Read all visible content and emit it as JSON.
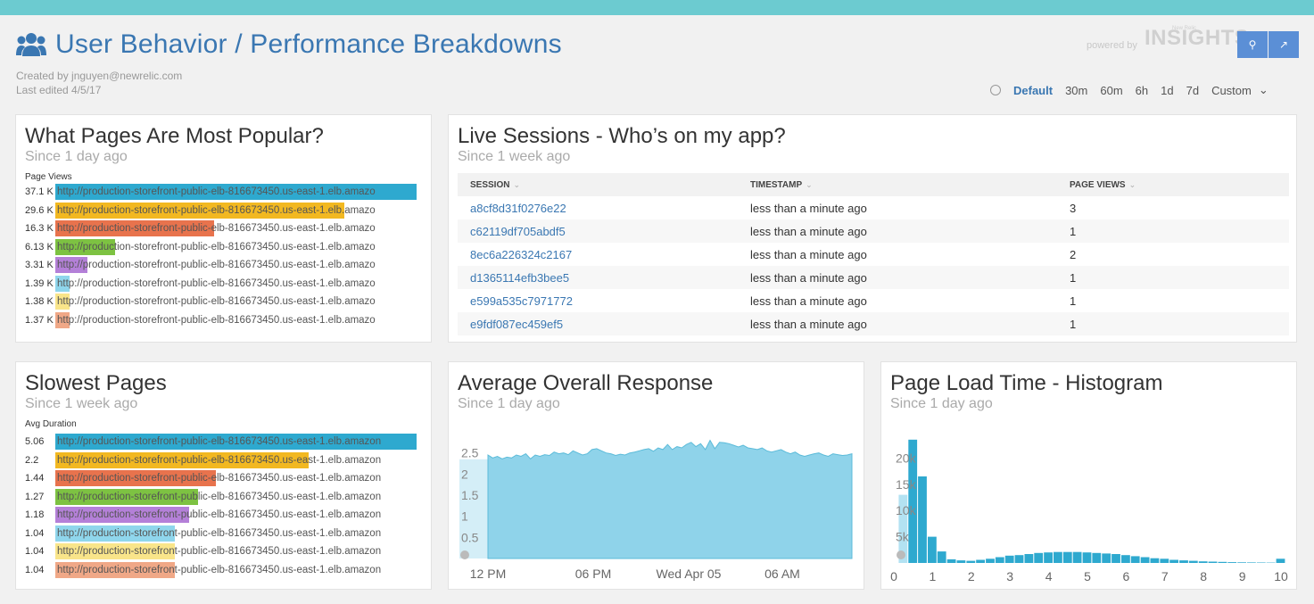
{
  "header": {
    "title": "User Behavior / Performance Breakdowns",
    "created_by": "Created by jnguyen@newrelic.com",
    "last_edited": "Last edited 4/5/17",
    "powered_by": "powered by",
    "insights_brand": "INSIGHTS",
    "insights_small": "New Relic",
    "time_options": [
      "Default",
      "30m",
      "60m",
      "6h",
      "1d",
      "7d",
      "Custom"
    ],
    "selected_time": "Default"
  },
  "popular_pages": {
    "title": "What Pages Are Most Popular?",
    "subtitle": "Since 1 day ago",
    "label": "Page Views",
    "rows": [
      {
        "value": "37.1 K",
        "fraction": 1.0,
        "color": "#2ea9cf",
        "url": "http://production-storefront-public-elb-816673450.us-east-1.elb.amazo"
      },
      {
        "value": "29.6 K",
        "fraction": 0.8,
        "color": "#f2b821",
        "url": "http://production-storefront-public-elb-816673450.us-east-1.elb.amazo"
      },
      {
        "value": "16.3 K",
        "fraction": 0.44,
        "color": "#e8734d",
        "url": "http://production-storefront-public-elb-816673450.us-east-1.elb.amazo"
      },
      {
        "value": "6.13 K",
        "fraction": 0.165,
        "color": "#7dc242",
        "url": "http://production-storefront-public-elb-816673450.us-east-1.elb.amazo"
      },
      {
        "value": "3.31 K",
        "fraction": 0.09,
        "color": "#b480d8",
        "url": "http://production-storefront-public-elb-816673450.us-east-1.elb.amazo"
      },
      {
        "value": "1.39 K",
        "fraction": 0.04,
        "color": "#8fd6ec",
        "url": "http://production-storefront-public-elb-816673450.us-east-1.elb.amazo"
      },
      {
        "value": "1.38 K",
        "fraction": 0.04,
        "color": "#f9e58a",
        "url": "http://production-storefront-public-elb-816673450.us-east-1.elb.amazo"
      },
      {
        "value": "1.37 K",
        "fraction": 0.04,
        "color": "#f0a887",
        "url": "http://production-storefront-public-elb-816673450.us-east-1.elb.amazo"
      }
    ]
  },
  "live_sessions": {
    "title": "Live Sessions - Who’s on my app?",
    "subtitle": "Since 1 week ago",
    "columns": [
      "SESSION",
      "TIMESTAMP",
      "PAGE VIEWS"
    ],
    "rows": [
      [
        "a8cf8d31f0276e22",
        "less than a minute ago",
        "3"
      ],
      [
        "c62119df705abdf5",
        "less than a minute ago",
        "1"
      ],
      [
        "8ec6a226324c2167",
        "less than a minute ago",
        "2"
      ],
      [
        "d1365114efb3bee5",
        "less than a minute ago",
        "1"
      ],
      [
        "e599a535c7971772",
        "less than a minute ago",
        "1"
      ],
      [
        "e9fdf087ec459ef5",
        "less than a minute ago",
        "1"
      ]
    ]
  },
  "slowest_pages": {
    "title": "Slowest Pages",
    "subtitle": "Since 1 week ago",
    "label": "Avg Duration",
    "rows": [
      {
        "value": "5.06",
        "fraction": 1.0,
        "color": "#2ea9cf",
        "url": "http://production-storefront-public-elb-816673450.us-east-1.elb.amazon"
      },
      {
        "value": "2.2",
        "fraction": 0.7,
        "color": "#f2b821",
        "url": "http://production-storefront-public-elb-816673450.us-east-1.elb.amazon"
      },
      {
        "value": "1.44",
        "fraction": 0.445,
        "color": "#e8734d",
        "url": "http://production-storefront-public-elb-816673450.us-east-1.elb.amazon"
      },
      {
        "value": "1.27",
        "fraction": 0.395,
        "color": "#7dc242",
        "url": "http://production-storefront-public-elb-816673450.us-east-1.elb.amazon"
      },
      {
        "value": "1.18",
        "fraction": 0.37,
        "color": "#b480d8",
        "url": "http://production-storefront-public-elb-816673450.us-east-1.elb.amazon"
      },
      {
        "value": "1.04",
        "fraction": 0.33,
        "color": "#8fd6ec",
        "url": "http://production-storefront-public-elb-816673450.us-east-1.elb.amazon"
      },
      {
        "value": "1.04",
        "fraction": 0.33,
        "color": "#f9e58a",
        "url": "http://production-storefront-public-elb-816673450.us-east-1.elb.amazon"
      },
      {
        "value": "1.04",
        "fraction": 0.33,
        "color": "#f0a887",
        "url": "http://production-storefront-public-elb-816673450.us-east-1.elb.amazon"
      }
    ]
  },
  "avg_response": {
    "title": "Average Overall Response",
    "subtitle": "Since 1 day ago"
  },
  "histogram": {
    "title": "Page Load Time - Histogram",
    "subtitle": "Since 1 day ago"
  },
  "chart_data": [
    {
      "type": "area",
      "title": "Average Overall Response",
      "x_ticks": [
        "12 PM",
        "06 PM",
        "Wed Apr 05",
        "06 AM"
      ],
      "y_ticks": [
        0.5,
        1,
        1.5,
        2,
        2.5
      ],
      "ylim": [
        0,
        3
      ],
      "color": "#8fd3ea",
      "values": [
        2.45,
        2.38,
        2.42,
        2.36,
        2.4,
        2.38,
        2.45,
        2.42,
        2.48,
        2.36,
        2.45,
        2.42,
        2.46,
        2.44,
        2.52,
        2.48,
        2.5,
        2.46,
        2.55,
        2.5,
        2.45,
        2.48,
        2.58,
        2.6,
        2.55,
        2.5,
        2.48,
        2.44,
        2.47,
        2.45,
        2.5,
        2.52,
        2.55,
        2.58,
        2.6,
        2.54,
        2.62,
        2.58,
        2.7,
        2.58,
        2.65,
        2.62,
        2.7,
        2.75,
        2.65,
        2.72,
        2.58,
        2.8,
        2.6,
        2.75,
        2.74,
        2.72,
        2.68,
        2.64,
        2.68,
        2.62,
        2.6,
        2.58,
        2.62,
        2.55,
        2.52,
        2.55,
        2.58,
        2.52,
        2.48,
        2.52,
        2.45,
        2.42,
        2.45,
        2.48,
        2.5,
        2.45,
        2.42,
        2.48,
        2.46,
        2.44,
        2.45,
        2.48
      ]
    },
    {
      "type": "bar",
      "title": "Page Load Time - Histogram",
      "x_ticks": [
        "0",
        "1",
        "2",
        "3",
        "4",
        "5",
        "6",
        "7",
        "8",
        "9",
        "10"
      ],
      "y_ticks": [
        "5k",
        "10k",
        "15k",
        "20k"
      ],
      "ylim": [
        0,
        25000
      ],
      "color": "#2ea9cf",
      "highlight_color": "#b3e2f2",
      "bin_width": 0.25,
      "bins": [
        13000,
        23500,
        16500,
        5000,
        2200,
        700,
        500,
        400,
        600,
        800,
        1100,
        1400,
        1500,
        1700,
        1900,
        2000,
        2100,
        2100,
        2100,
        2000,
        1900,
        1800,
        1700,
        1500,
        1300,
        1100,
        900,
        800,
        600,
        500,
        400,
        300,
        250,
        200,
        150,
        120,
        100,
        80,
        60,
        800
      ]
    }
  ]
}
